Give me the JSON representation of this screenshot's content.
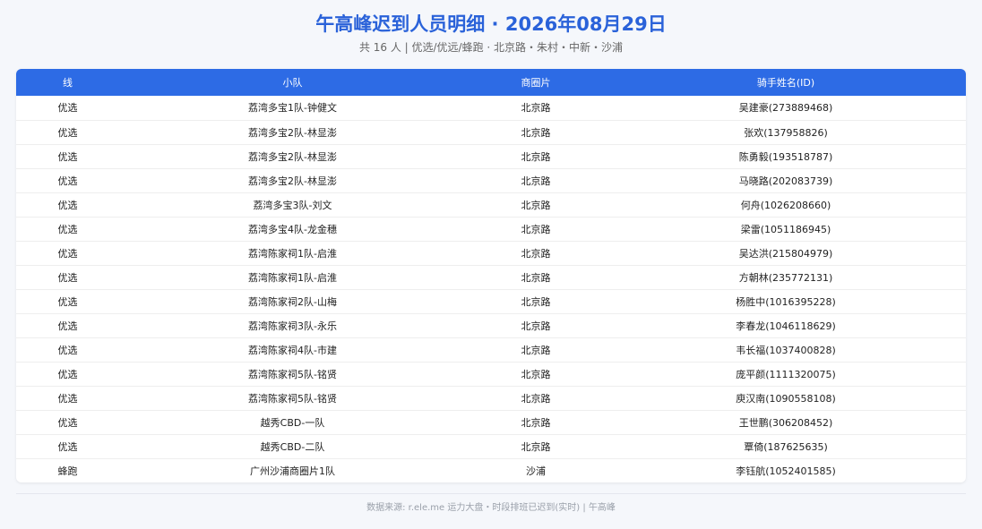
{
  "header": {
    "title": "午高峰迟到人员明细 · 2026年08月29日",
    "subtitle": "共 16 人 | 优选/优远/蜂跑 · 北京路・朱村・中新・沙浦"
  },
  "table": {
    "columns": [
      "线",
      "小队",
      "商圈片",
      "骑手姓名(ID)"
    ],
    "rows": [
      [
        "优选",
        "荔湾多宝1队-钟健文",
        "北京路",
        "吴建豪(273889468)"
      ],
      [
        "优选",
        "荔湾多宝2队-林显澎",
        "北京路",
        "张欢(137958826)"
      ],
      [
        "优选",
        "荔湾多宝2队-林显澎",
        "北京路",
        "陈勇毅(193518787)"
      ],
      [
        "优选",
        "荔湾多宝2队-林显澎",
        "北京路",
        "马晓路(202083739)"
      ],
      [
        "优选",
        "荔湾多宝3队-刘文",
        "北京路",
        "何舟(1026208660)"
      ],
      [
        "优选",
        "荔湾多宝4队-龙金穗",
        "北京路",
        "梁雷(1051186945)"
      ],
      [
        "优选",
        "荔湾陈家祠1队-启淮",
        "北京路",
        "吴达洪(215804979)"
      ],
      [
        "优选",
        "荔湾陈家祠1队-启淮",
        "北京路",
        "方朝林(235772131)"
      ],
      [
        "优选",
        "荔湾陈家祠2队-山梅",
        "北京路",
        "杨胜中(1016395228)"
      ],
      [
        "优选",
        "荔湾陈家祠3队-永乐",
        "北京路",
        "李春龙(1046118629)"
      ],
      [
        "优选",
        "荔湾陈家祠4队-市建",
        "北京路",
        "韦长福(1037400828)"
      ],
      [
        "优选",
        "荔湾陈家祠5队-铭贤",
        "北京路",
        "庞平颜(1111320075)"
      ],
      [
        "优选",
        "荔湾陈家祠5队-铭贤",
        "北京路",
        "庾汉南(1090558108)"
      ],
      [
        "优选",
        "越秀CBD-一队",
        "北京路",
        "王世鹏(306208452)"
      ],
      [
        "优选",
        "越秀CBD-二队",
        "北京路",
        "覃倚(187625635)"
      ],
      [
        "蜂跑",
        "广州沙浦商圈片1队",
        "沙浦",
        "李钰航(1052401585)"
      ]
    ]
  },
  "footer": {
    "text": "数据来源: r.ele.me 运力大盘・时段排班已迟到(实时) | 午高峰"
  },
  "colors": {
    "title": "#2a62d9",
    "header_bg": "#2d6be5",
    "page_bg": "#f5f7fb"
  }
}
